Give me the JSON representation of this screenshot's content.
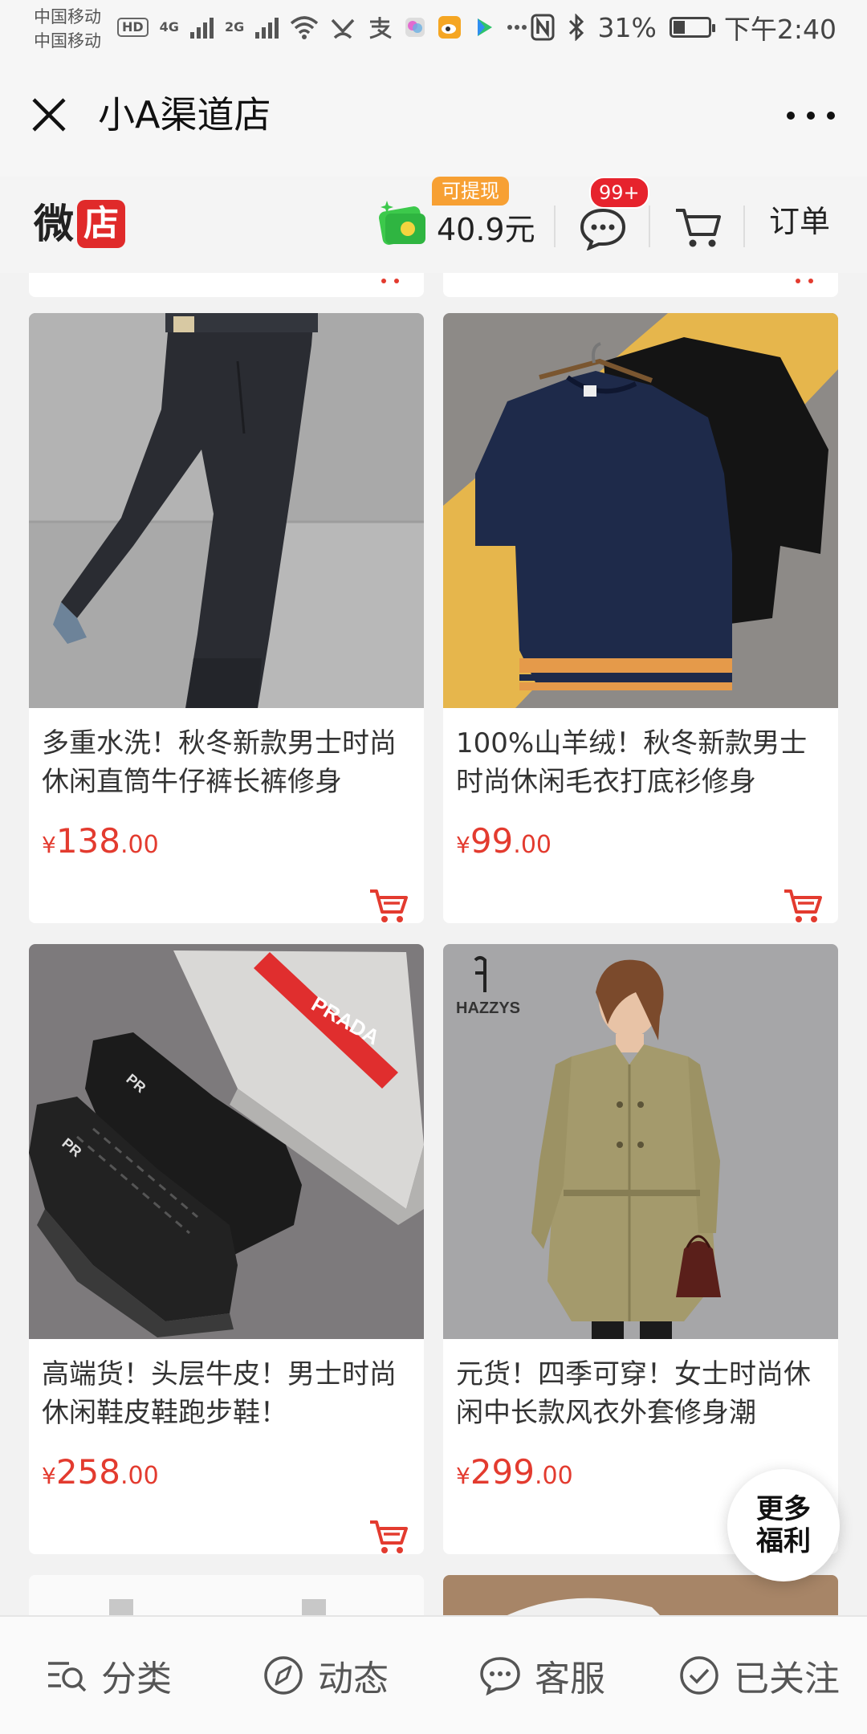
{
  "status_bar": {
    "carrier_1": "中国移动",
    "carrier_2": "中国移动",
    "hd": "HD",
    "net_1": "4G",
    "net_2": "2G",
    "battery_percent": "31%",
    "battery_level": 0.31,
    "time": "下午2:40"
  },
  "title_bar": {
    "title": "小A渠道店"
  },
  "shop_header": {
    "logo_wei": "微",
    "logo_dian": "店",
    "withdraw_badge": "可提现",
    "balance": "40.9元",
    "message_badge": "99+",
    "orders_label": "订单"
  },
  "products": [
    {
      "title": "多重水洗！秋冬新款男士时尚休闲直筒牛仔裤长裤修身",
      "currency": "¥",
      "price_int": "138",
      "price_dec": ".00",
      "image": "dark-jeans-photo"
    },
    {
      "title": "100%山羊绒！秋冬新款男士时尚休闲毛衣打底衫修身",
      "currency": "¥",
      "price_int": "99",
      "price_dec": ".00",
      "image": "cashmere-sweaters-photo"
    },
    {
      "title": "高端货！头层牛皮！男士时尚休闲鞋皮鞋跑步鞋！",
      "currency": "¥",
      "price_int": "258",
      "price_dec": ".00",
      "image": "leather-shoes-photo",
      "brand_text": "PRADA"
    },
    {
      "title": "元货！四季可穿！女士时尚休闲中长款风衣外套修身潮",
      "currency": "¥",
      "price_int": "299",
      "price_dec": ".00",
      "image": "trench-coat-photo",
      "brand_text": "HAZZYS"
    }
  ],
  "float_button": {
    "line1": "更多",
    "line2": "福利"
  },
  "bottom_nav": [
    {
      "label": "分类",
      "icon": "category-search-icon"
    },
    {
      "label": "动态",
      "icon": "compass-icon"
    },
    {
      "label": "客服",
      "icon": "chat-bubble-icon"
    },
    {
      "label": "已关注",
      "icon": "check-circle-icon"
    }
  ],
  "colors": {
    "price": "#e33b2f",
    "badge_red": "#e6232d",
    "badge_orange": "#f7a033",
    "logo_red": "#e02a2a",
    "wallet_green": "#3cc94b"
  }
}
